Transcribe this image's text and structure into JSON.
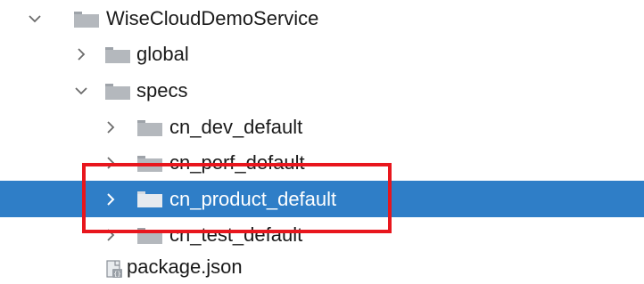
{
  "tree": {
    "items": [
      {
        "label": "WiseCloudDemoService",
        "expanded": true,
        "icon": "folder-icon",
        "arrow": "chevron-down-icon"
      },
      {
        "label": "global",
        "expanded": false,
        "icon": "folder-icon",
        "arrow": "chevron-right-icon"
      },
      {
        "label": "specs",
        "expanded": true,
        "icon": "folder-icon",
        "arrow": "chevron-down-icon"
      },
      {
        "label": "cn_dev_default",
        "expanded": false,
        "icon": "folder-icon",
        "arrow": "chevron-right-icon"
      },
      {
        "label": "cn_perf_default",
        "expanded": false,
        "icon": "folder-icon",
        "arrow": "chevron-right-icon"
      },
      {
        "label": "cn_product_default",
        "expanded": false,
        "selected": true,
        "icon": "folder-icon",
        "arrow": "chevron-right-icon"
      },
      {
        "label": "cn_test_default",
        "expanded": false,
        "icon": "folder-icon",
        "arrow": "chevron-right-icon"
      },
      {
        "label": "package.json",
        "icon": "json-file-icon"
      }
    ]
  },
  "colors": {
    "selection": "#2f7ec7",
    "highlight_border": "#e8161d",
    "folder": "#b4b8bd"
  }
}
